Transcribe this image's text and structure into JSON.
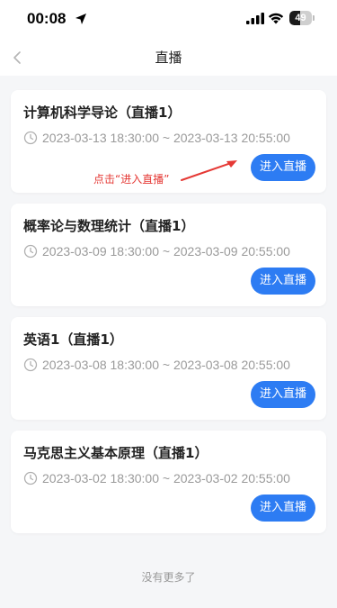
{
  "status_bar": {
    "time": "00:08",
    "battery_level": "49",
    "battery_fraction": 0.49,
    "icons": [
      "location-arrow-icon",
      "signal-icon",
      "wifi-icon",
      "battery-icon"
    ]
  },
  "nav": {
    "title": "直播",
    "back_icon": "chevron-left-icon"
  },
  "colors": {
    "accent": "#2d7cf3",
    "annotation": "#e53935",
    "time_text": "#9a9a9a",
    "background": "#f5f6f8"
  },
  "courses": [
    {
      "title": "计算机科学导论（直播1）",
      "time": "2023-03-13 18:30:00 ~ 2023-03-13 20:55:00",
      "button_label": "进入直播"
    },
    {
      "title": "概率论与数理统计（直播1）",
      "time": "2023-03-09 18:30:00 ~ 2023-03-09 20:55:00",
      "button_label": "进入直播"
    },
    {
      "title": "英语1（直播1）",
      "time": "2023-03-08 18:30:00 ~ 2023-03-08 20:55:00",
      "button_label": "进入直播"
    },
    {
      "title": "马克思主义基本原理（直播1）",
      "time": "2023-03-02 18:30:00 ~ 2023-03-02 20:55:00",
      "button_label": "进入直播"
    }
  ],
  "annotation": {
    "text": "点击“进入直播”"
  },
  "footer": {
    "no_more_text": "没有更多了"
  }
}
